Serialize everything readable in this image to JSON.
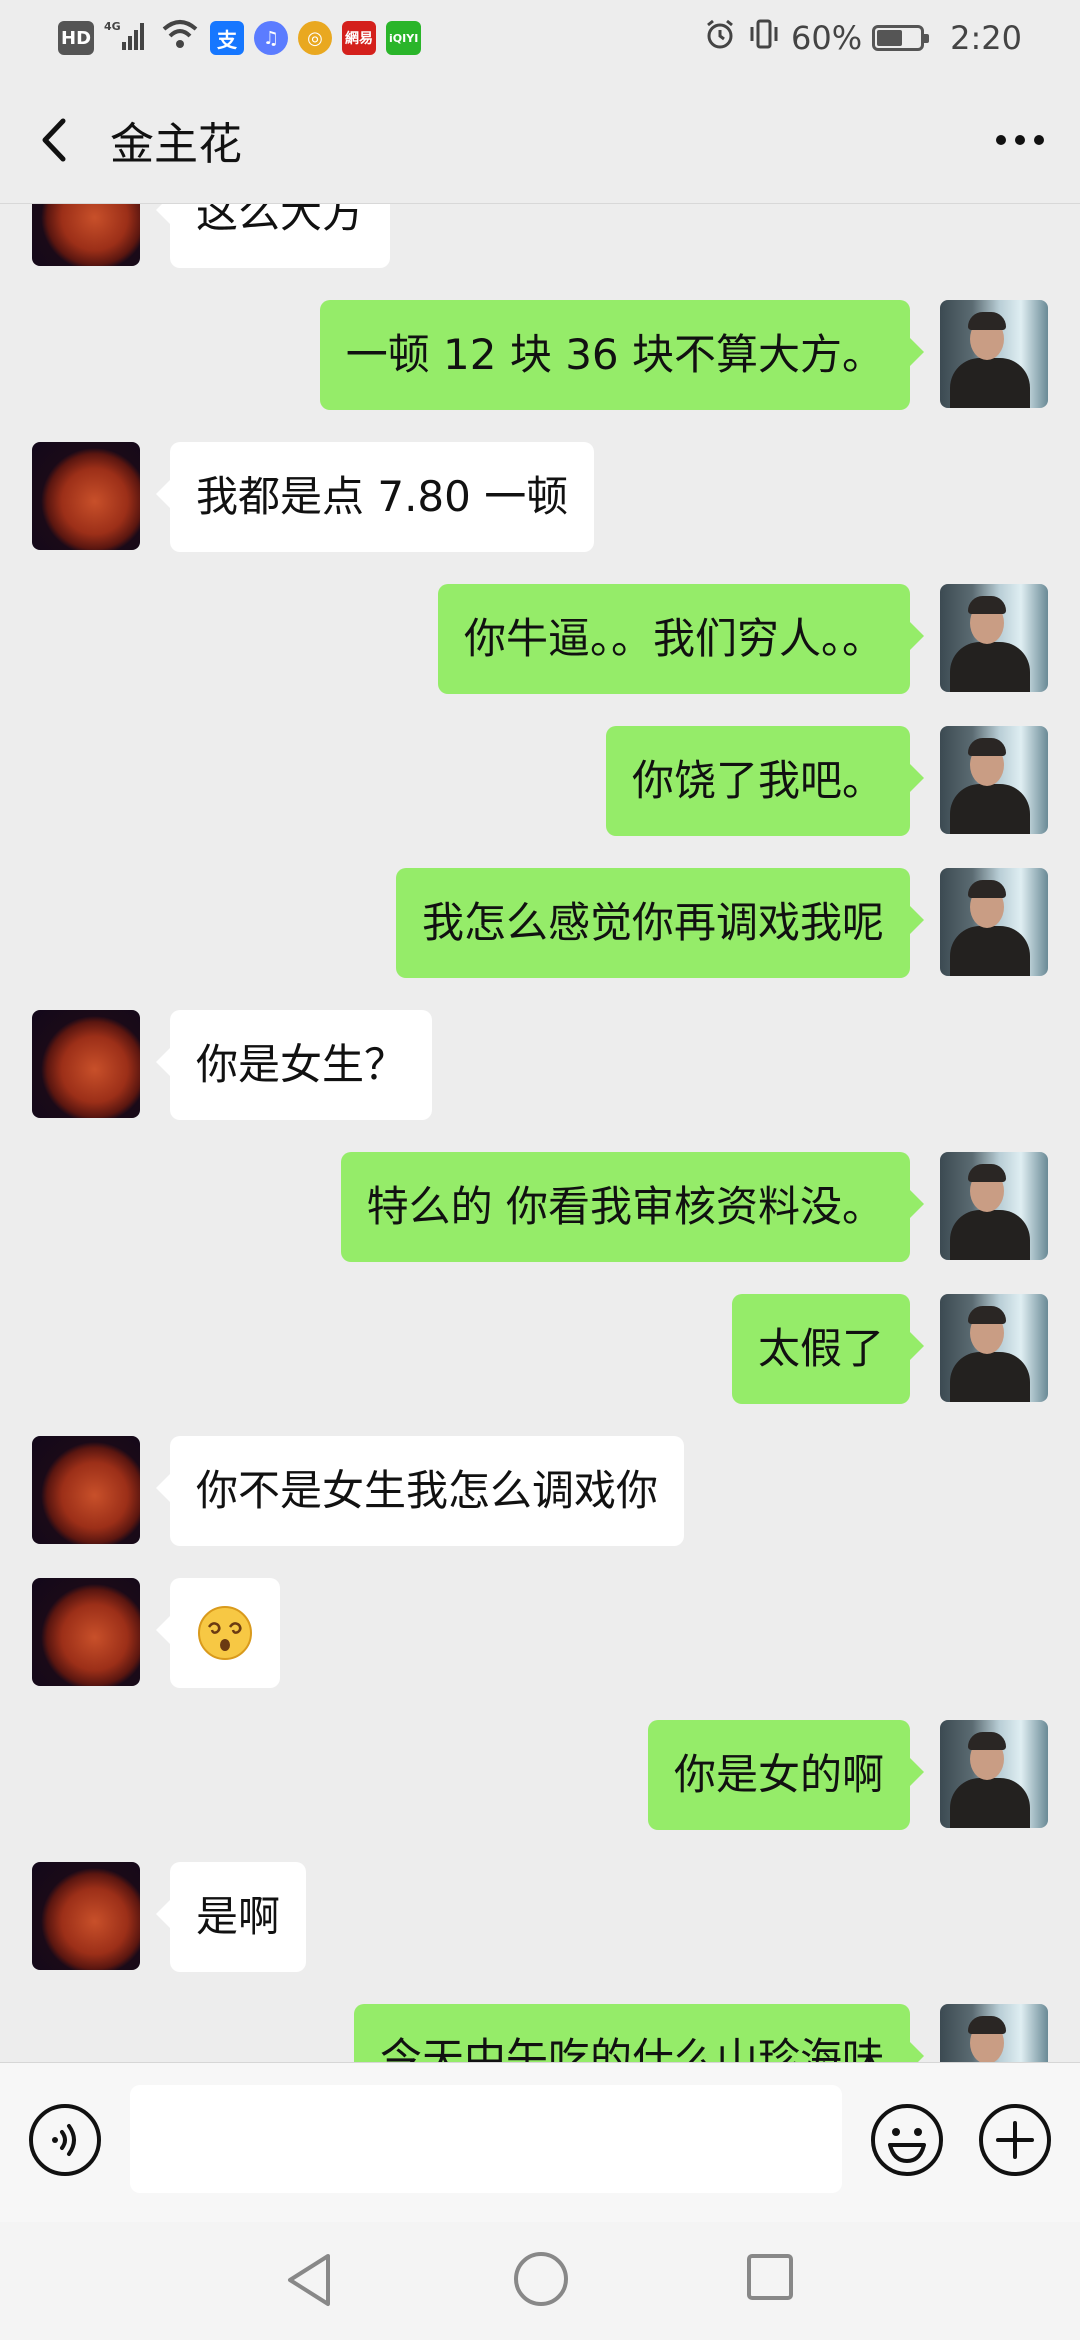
{
  "status_bar": {
    "left_icons": [
      {
        "name": "hd-icon",
        "label": "HD",
        "bg": "#555555"
      },
      {
        "name": "4g-signal-icon",
        "label": "4G",
        "bg": "transparent"
      },
      {
        "name": "wifi-icon",
        "label": "",
        "bg": "transparent"
      },
      {
        "name": "alipay-icon",
        "label": "支",
        "bg": "#1677ff"
      },
      {
        "name": "music-icon",
        "label": "♫",
        "bg": "#5b7cff"
      },
      {
        "name": "chrome-icon",
        "label": "◎",
        "bg": "#e9a820"
      },
      {
        "name": "netease-icon",
        "label": "網易",
        "bg": "#d4201c"
      },
      {
        "name": "iqiyi-icon",
        "label": "iQIYI",
        "bg": "#2ab52a"
      }
    ],
    "battery": "60%",
    "battery_level": 0.6,
    "time": "2:20"
  },
  "header": {
    "title": "金主花"
  },
  "messages": [
    {
      "side": "left",
      "text": "这么大方"
    },
    {
      "side": "right",
      "text": "一顿 12 块  36 块不算大方。"
    },
    {
      "side": "left",
      "text": "我都是点 7.80 一顿"
    },
    {
      "side": "right",
      "text": "你牛逼。。我们穷人。。"
    },
    {
      "side": "right",
      "text": "你饶了我吧。"
    },
    {
      "side": "right",
      "text": "我怎么感觉你再调戏我呢"
    },
    {
      "side": "left",
      "text": "你是女生？"
    },
    {
      "side": "right",
      "text": "特么的  你看我审核资料没。"
    },
    {
      "side": "right",
      "text": "太假了"
    },
    {
      "side": "left",
      "text": "你不是女生我怎么调戏你"
    },
    {
      "side": "left",
      "text": "",
      "emoji": "dizzy-face"
    },
    {
      "side": "right",
      "text": "你是女的啊"
    },
    {
      "side": "left",
      "text": "是啊"
    },
    {
      "side": "right",
      "text": "今天中午吃的什么山珍海味"
    }
  ],
  "colors": {
    "bubble_self": "#95ec69",
    "bubble_other": "#ffffff",
    "background": "#ededed"
  },
  "input": {
    "value": "",
    "placeholder": ""
  }
}
